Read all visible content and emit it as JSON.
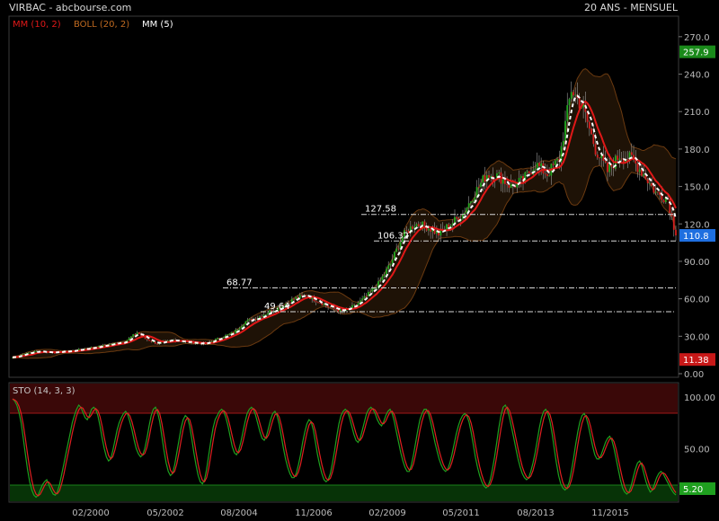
{
  "header": {
    "title_left": "VIRBAC - abcbourse.com",
    "title_right": "20 ANS - MENSUEL"
  },
  "legend": {
    "mm10": "MM (10, 2)",
    "boll": "BOLL (20, 2)",
    "mm5": "MM (5)",
    "sto": "STO (14, 3, 3)"
  },
  "colors": {
    "background": "#000000",
    "bull_candle": "#22a822",
    "bear_candle": "#d42020",
    "mm10": "#e01818",
    "mm5": "#ffffff",
    "boll_band": "#6b3a10",
    "boll_fill": "#1e1206",
    "price_badge": "#1f6fe0",
    "high_badge": "#1a8a1a",
    "low_badge": "#c81818",
    "sto_k": "#1fa01f",
    "sto_d": "#e02020"
  },
  "chart_data": [
    {
      "type": "candlestick",
      "title": "VIRBAC - abcbourse.com",
      "x_ticks": [
        "02/2000",
        "05/2002",
        "08/2004",
        "11/2006",
        "02/2009",
        "05/2011",
        "08/2013",
        "11/2015"
      ],
      "y_ticks": [
        "0.00",
        "30.00",
        "60.00",
        "90.00",
        "120.0",
        "150.0",
        "180.0",
        "210.0",
        "240.0",
        "270.0"
      ],
      "ylim": [
        0,
        285
      ],
      "grid": false,
      "levels": [
        {
          "label": "127.58",
          "value": 127.58
        },
        {
          "label": "106.32",
          "value": 106.32
        },
        {
          "label": "68.77",
          "value": 68.77
        },
        {
          "label": "49.64",
          "value": 49.64
        }
      ],
      "badges": {
        "high": "257.9",
        "last": "110.8",
        "low": "11.38"
      },
      "series": [
        {
          "name": "MM (10, 2)",
          "role": "moving average"
        },
        {
          "name": "BOLL (20, 2)",
          "role": "bollinger bands"
        },
        {
          "name": "MM (5)",
          "role": "moving average"
        }
      ],
      "anchors": [
        {
          "t": 0,
          "v": 13
        },
        {
          "t": 6,
          "v": 16
        },
        {
          "t": 12,
          "v": 18
        },
        {
          "t": 20,
          "v": 17
        },
        {
          "t": 28,
          "v": 18
        },
        {
          "t": 36,
          "v": 20
        },
        {
          "t": 44,
          "v": 22
        },
        {
          "t": 50,
          "v": 24
        },
        {
          "t": 56,
          "v": 26
        },
        {
          "t": 62,
          "v": 33
        },
        {
          "t": 66,
          "v": 28
        },
        {
          "t": 72,
          "v": 24
        },
        {
          "t": 80,
          "v": 27
        },
        {
          "t": 88,
          "v": 25
        },
        {
          "t": 96,
          "v": 24
        },
        {
          "t": 102,
          "v": 28
        },
        {
          "t": 110,
          "v": 33
        },
        {
          "t": 116,
          "v": 42
        },
        {
          "t": 122,
          "v": 45
        },
        {
          "t": 128,
          "v": 50
        },
        {
          "t": 134,
          "v": 54
        },
        {
          "t": 140,
          "v": 60
        },
        {
          "t": 146,
          "v": 63
        },
        {
          "t": 152,
          "v": 58
        },
        {
          "t": 158,
          "v": 53
        },
        {
          "t": 164,
          "v": 50
        },
        {
          "t": 170,
          "v": 54
        },
        {
          "t": 176,
          "v": 62
        },
        {
          "t": 182,
          "v": 72
        },
        {
          "t": 188,
          "v": 88
        },
        {
          "t": 194,
          "v": 110
        },
        {
          "t": 200,
          "v": 120
        },
        {
          "t": 206,
          "v": 118
        },
        {
          "t": 212,
          "v": 112
        },
        {
          "t": 218,
          "v": 120
        },
        {
          "t": 224,
          "v": 128
        },
        {
          "t": 230,
          "v": 145
        },
        {
          "t": 236,
          "v": 160
        },
        {
          "t": 242,
          "v": 158
        },
        {
          "t": 248,
          "v": 150
        },
        {
          "t": 254,
          "v": 155
        },
        {
          "t": 260,
          "v": 168
        },
        {
          "t": 266,
          "v": 160
        },
        {
          "t": 272,
          "v": 172
        },
        {
          "t": 278,
          "v": 228
        },
        {
          "t": 284,
          "v": 212
        },
        {
          "t": 290,
          "v": 180
        },
        {
          "t": 296,
          "v": 162
        },
        {
          "t": 302,
          "v": 175
        },
        {
          "t": 308,
          "v": 172
        },
        {
          "t": 314,
          "v": 160
        },
        {
          "t": 320,
          "v": 145
        },
        {
          "t": 326,
          "v": 140
        },
        {
          "t": 330,
          "v": 110.8
        }
      ]
    },
    {
      "type": "line",
      "title": "STO (14, 3, 3)",
      "y_ticks": [
        "100.00",
        "50.00"
      ],
      "ylim": [
        0,
        112
      ],
      "zones": {
        "overbought": 80,
        "oversold": 5
      },
      "badges": {
        "k": "5.20"
      },
      "series": [
        {
          "name": "K",
          "values": [
            98,
            96,
            92,
            85,
            75,
            60,
            45,
            30,
            18,
            10,
            5,
            3,
            5,
            10,
            15,
            18,
            20,
            15,
            10,
            6,
            5,
            8,
            15,
            25,
            35,
            45,
            55,
            65,
            75,
            82,
            88,
            92,
            90,
            85,
            80,
            78,
            82,
            88,
            90,
            88,
            82,
            72,
            60,
            50,
            42,
            38,
            40,
            48,
            58,
            68,
            75,
            80,
            84,
            86,
            83,
            76,
            68,
            58,
            50,
            45,
            42,
            44,
            50,
            60,
            72,
            82,
            88,
            90,
            85,
            76,
            62,
            48,
            36,
            28,
            24,
            26,
            34,
            46,
            58,
            70,
            78,
            82,
            80,
            72,
            60,
            46,
            34,
            24,
            18,
            16,
            20,
            30,
            44,
            58,
            70,
            78,
            82,
            86,
            88,
            86,
            80,
            72,
            62,
            52,
            46,
            44,
            48,
            56,
            66,
            76,
            84,
            88,
            90,
            88,
            82,
            74,
            66,
            60,
            58,
            62,
            70,
            78,
            84,
            86,
            82,
            74,
            62,
            50,
            40,
            32,
            26,
            22,
            22,
            26,
            34,
            44,
            56,
            66,
            74,
            78,
            76,
            68,
            56,
            44,
            34,
            26,
            20,
            18,
            20,
            26,
            36,
            48,
            62,
            74,
            82,
            86,
            88,
            86,
            80,
            72,
            64,
            58,
            56,
            60,
            68,
            76,
            84,
            88,
            90,
            88,
            84,
            78,
            74,
            72,
            76,
            82,
            86,
            88,
            84,
            76,
            66,
            56,
            46,
            38,
            32,
            28,
            28,
            34,
            44,
            56,
            68,
            78,
            84,
            88,
            88,
            84,
            76,
            66,
            56,
            48,
            40,
            34,
            30,
            28,
            30,
            36,
            44,
            54,
            64,
            72,
            78,
            82,
            84,
            82,
            76,
            66,
            54,
            42,
            32,
            24,
            18,
            14,
            12,
            14,
            20,
            30,
            42,
            56,
            70,
            82,
            90,
            92,
            88,
            80,
            70,
            60,
            50,
            40,
            32,
            26,
            22,
            20,
            22,
            28,
            36,
            46,
            58,
            70,
            80,
            86,
            88,
            84,
            76,
            64,
            50,
            36,
            24,
            16,
            12,
            10,
            12,
            18,
            28,
            40,
            54,
            66,
            76,
            82,
            84,
            80,
            72,
            62,
            52,
            44,
            40,
            40,
            44,
            50,
            56,
            60,
            62,
            58,
            50,
            40,
            30,
            20,
            12,
            8,
            6,
            8,
            14,
            22,
            30,
            36,
            38,
            34,
            26,
            18,
            12,
            8,
            10,
            16,
            22,
            26,
            28,
            26,
            22,
            18,
            14,
            10,
            7,
            5.2
          ]
        }
      ]
    }
  ]
}
